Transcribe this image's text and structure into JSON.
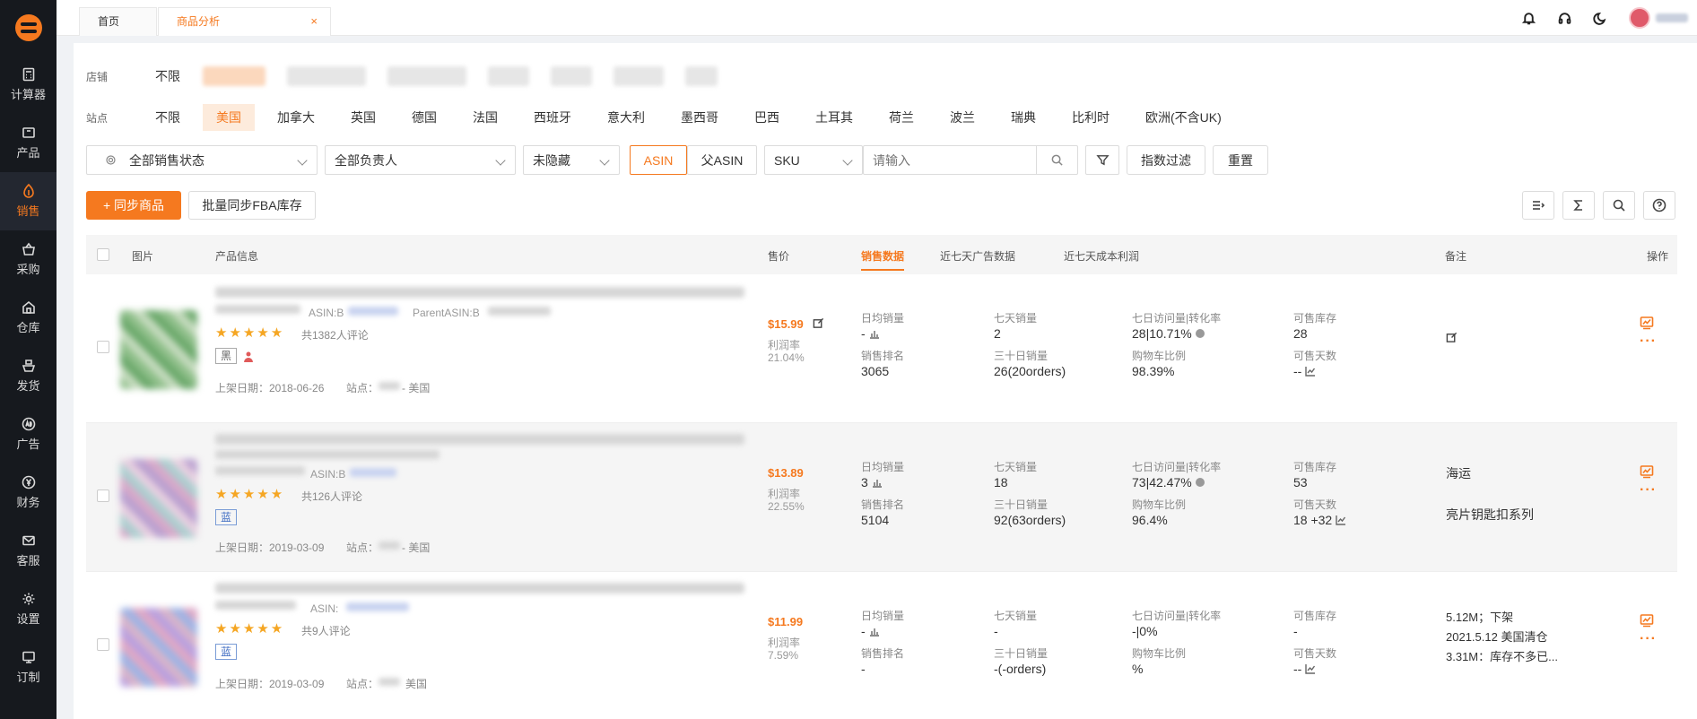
{
  "sidebar": {
    "items": [
      {
        "label": "计算器",
        "icon": "calculator-icon"
      },
      {
        "label": "产品",
        "icon": "box-icon"
      },
      {
        "label": "销售",
        "icon": "sales-icon"
      },
      {
        "label": "采购",
        "icon": "basket-icon"
      },
      {
        "label": "仓库",
        "icon": "warehouse-icon"
      },
      {
        "label": "发货",
        "icon": "ship-icon"
      },
      {
        "label": "广告",
        "icon": "ad-icon"
      },
      {
        "label": "财务",
        "icon": "yen-icon"
      },
      {
        "label": "客服",
        "icon": "mail-icon"
      },
      {
        "label": "设置",
        "icon": "gear-icon"
      },
      {
        "label": "订制",
        "icon": "monitor-icon"
      }
    ],
    "active": "销售"
  },
  "tabs": {
    "home": "首页",
    "active": "商品分析",
    "close": "×"
  },
  "filters": {
    "store_label": "店铺",
    "store_all": "不限",
    "site_label": "站点",
    "sites": [
      "不限",
      "美国",
      "加拿大",
      "英国",
      "德国",
      "法国",
      "西班牙",
      "意大利",
      "墨西哥",
      "巴西",
      "土耳其",
      "荷兰",
      "波兰",
      "瑞典",
      "比利时",
      "欧洲(不含UK)"
    ],
    "active_site": "美国"
  },
  "controls": {
    "sales_status": "全部销售状态",
    "owner": "全部负责人",
    "hidden": "未隐藏",
    "asin": "ASIN",
    "parent_asin": "父ASIN",
    "sku": "SKU",
    "search_placeholder": "请输入",
    "index_filter": "指数过滤",
    "reset": "重置",
    "sync": "+ 同步商品",
    "batch_sync": "批量同步FBA库存"
  },
  "table": {
    "headers": {
      "image": "图片",
      "product": "产品信息",
      "price": "售价",
      "tab_sales": "销售数据",
      "tab_ads": "近七天广告数据",
      "tab_profit": "近七天成本利润",
      "remark": "备注",
      "ops": "操作"
    },
    "labels": {
      "profit_rate": "利润率",
      "daily_sales": "日均销量",
      "sales_rank": "销售排名",
      "seven_day_sales": "七天销量",
      "thirty_day_sales": "三十日销量",
      "visits_conv": "七日访问量|转化率",
      "cart_ratio": "购物车比例",
      "sellable_stock": "可售库存",
      "sellable_days": "可售天数",
      "listed": "上架日期:",
      "site": "站点:",
      "parent_asin": "ParentASIN:",
      "asin": "ASIN:"
    },
    "rows": [
      {
        "asin_prefix": "ASIN:B",
        "parent": "ParentASIN:B",
        "stars": "★★★★★",
        "reviews": "共1382人评论",
        "tag": "黑",
        "date": "上架日期：2018-06-26",
        "site": "站点：",
        "site_country": "- 美国",
        "price": "$15.99",
        "profit": "21.04%",
        "daily": "-",
        "rank": "3065",
        "seven": "2",
        "thirty": "26(20orders)",
        "visits": "28|10.71%",
        "cart": "98.39%",
        "stock": "28",
        "days": "--",
        "remark": [
          "",
          ""
        ]
      },
      {
        "asin_prefix": "ASIN:B",
        "parent": "",
        "stars": "★★★★★",
        "reviews": "共126人评论",
        "tag": "蓝",
        "date": "上架日期：2019-03-09",
        "site": "站点：",
        "site_country": "- 美国",
        "price": "$13.89",
        "profit": "22.55%",
        "daily": "3",
        "rank": "5104",
        "seven": "18",
        "thirty": "92(63orders)",
        "visits": "73|42.47%",
        "cart": "96.4%",
        "stock": "53",
        "days": "18 +32",
        "remark": [
          "海运",
          "亮片钥匙扣系列"
        ]
      },
      {
        "asin_prefix": "ASIN:",
        "parent": "",
        "stars": "★★★★★",
        "reviews": "共9人评论",
        "tag": "蓝",
        "date": "上架日期：2019-03-09",
        "site": "站点：",
        "site_country": "美国",
        "price": "$11.99",
        "profit": "7.59%",
        "daily": "-",
        "rank": "-",
        "seven": "-",
        "thirty": "-(-orders)",
        "visits": "-|0%",
        "cart": "%",
        "stock": "-",
        "days": "--",
        "remark": [
          "5.12M；下架",
          "2021.5.12 美国清仓",
          "3.31M：库存不多已..."
        ]
      }
    ]
  },
  "colors": {
    "accent": "#f5791f",
    "sidebar_bg": "#16191e"
  }
}
